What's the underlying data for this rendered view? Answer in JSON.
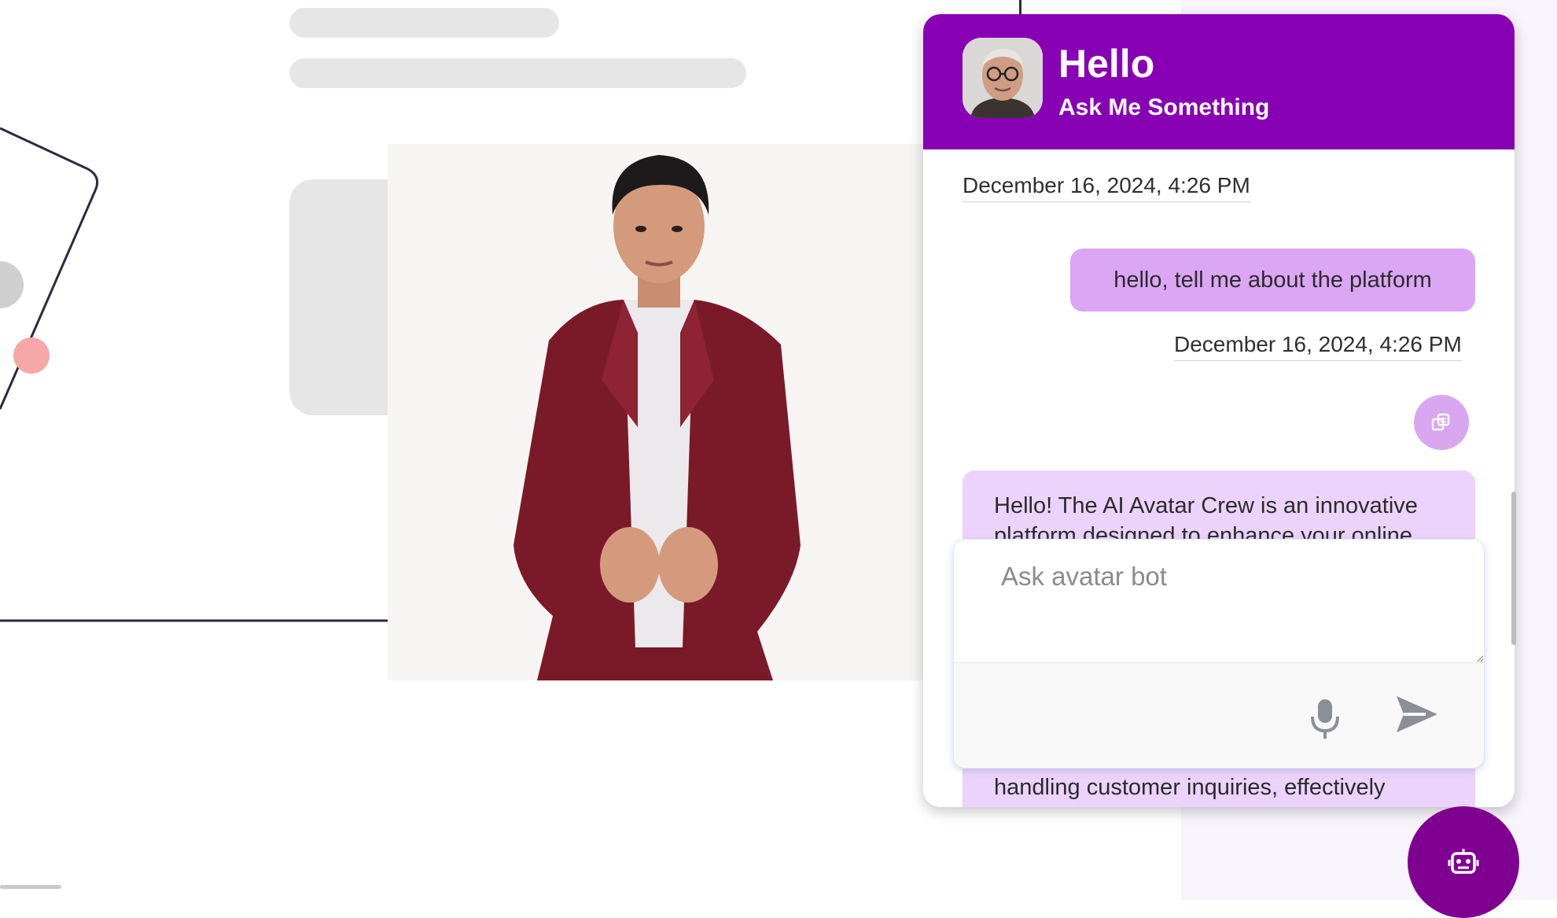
{
  "chat": {
    "header": {
      "title": "Hello",
      "subtitle": "Ask Me Something"
    },
    "messages": [
      {
        "role": "timestamp",
        "text": "December 16, 2024, 4:26 PM"
      },
      {
        "role": "user",
        "text": "hello, tell me about the platform"
      },
      {
        "role": "timestamp",
        "text": "December 16, 2024, 4:26 PM"
      },
      {
        "role": "bot",
        "text_top": "Hello! The AI Avatar Crew is an innovative",
        "text_partial": "platform designed to enhance your online",
        "text_bottom": "handling customer inquiries, effectively"
      }
    ],
    "input": {
      "placeholder": "Ask avatar bot",
      "value": ""
    },
    "icons": {
      "copy": "copy-icon",
      "mic": "microphone-icon",
      "send": "send-icon",
      "launcher": "robot-icon"
    }
  },
  "colors": {
    "header": "#8700b4",
    "user_bubble": "#dba6f4",
    "bot_bubble": "#ecd3fb",
    "launcher": "#7f0090",
    "side_panel": "#f8f4fc"
  }
}
